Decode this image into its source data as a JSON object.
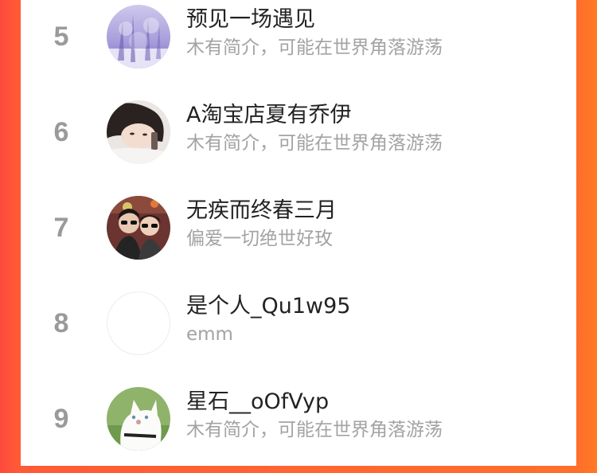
{
  "ranking": {
    "items": [
      {
        "rank": "5",
        "name": "预见一场遇见",
        "bio": "木有简介，可能在世界角落游荡",
        "avatar_icon": "snowy-forest-avatar"
      },
      {
        "rank": "6",
        "name": "A淘宝店夏有乔伊",
        "bio": "木有简介，可能在世界角落游荡",
        "avatar_icon": "girl-portrait-avatar"
      },
      {
        "rank": "7",
        "name": "无疾而终春三月",
        "bio": "偏爱一切绝世好玫",
        "avatar_icon": "couple-sunglasses-avatar"
      },
      {
        "rank": "8",
        "name": "是个人_Qu1w95",
        "bio": "emm",
        "avatar_icon": "blank-avatar"
      },
      {
        "rank": "9",
        "name": "星石__oOfVyp",
        "bio": "木有简介，可能在世界角落游荡",
        "avatar_icon": "white-cat-avatar"
      }
    ]
  },
  "colors": {
    "background_left": "#fe4a3d",
    "background_right": "#ff7a23",
    "rank_text": "#9a9a9a",
    "name_text": "#222222",
    "bio_text": "#a3a3a3"
  }
}
